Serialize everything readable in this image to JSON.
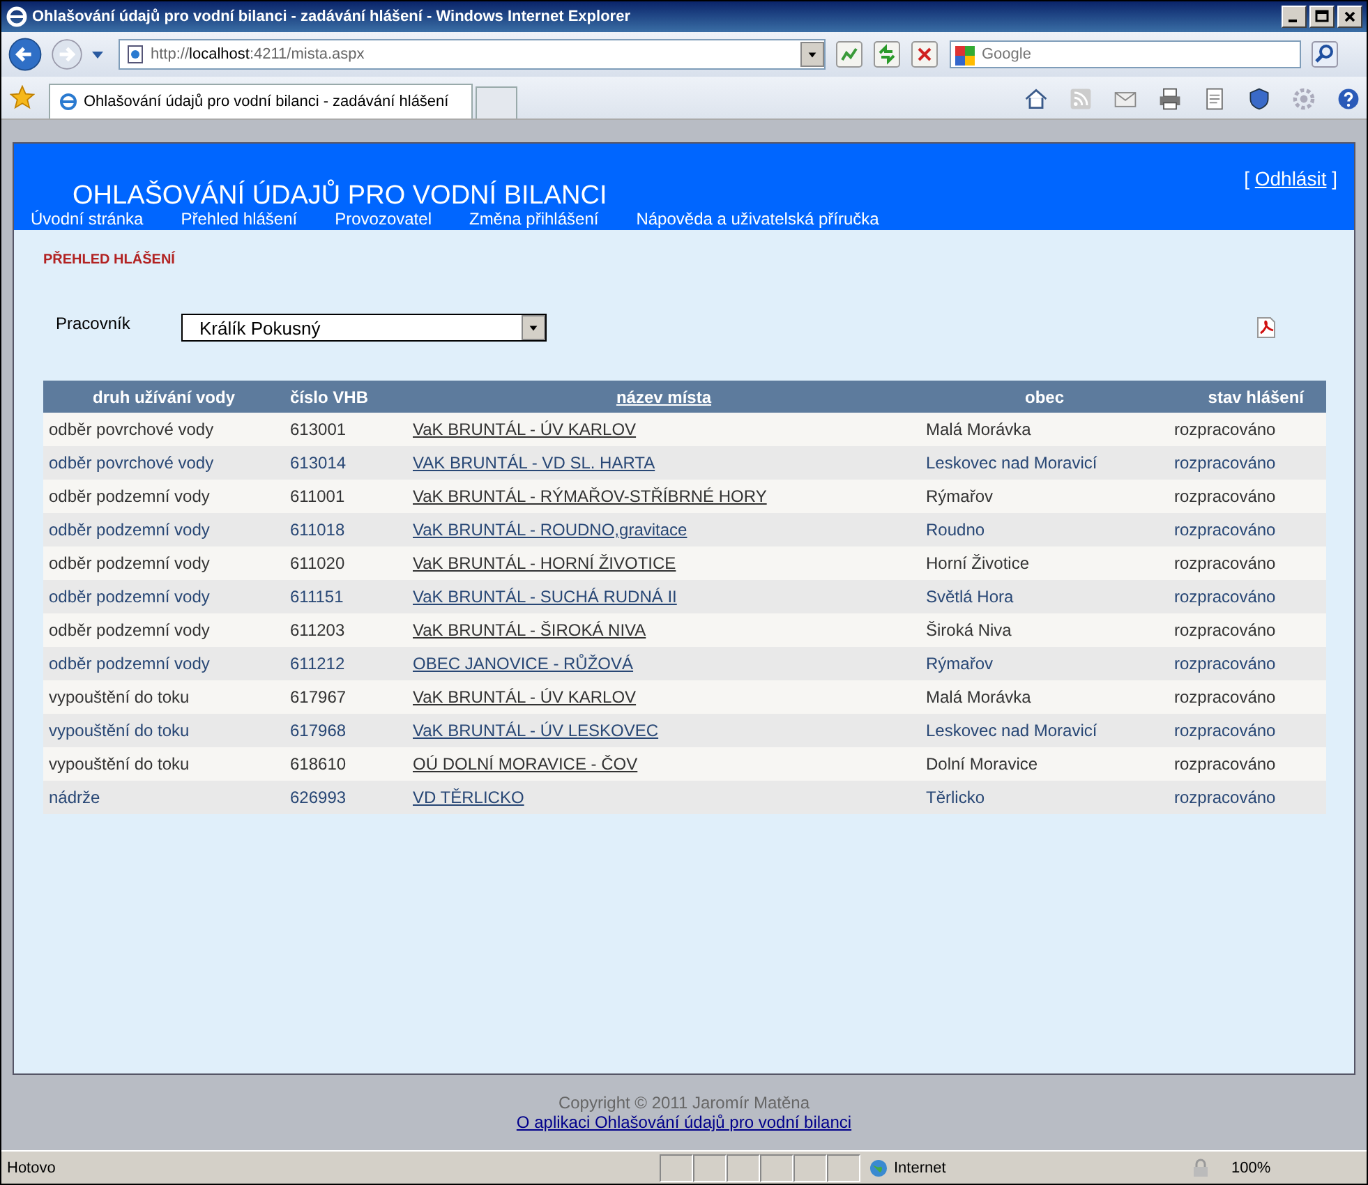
{
  "window": {
    "title": "Ohlašování údajů pro vodní bilanci - zadávání hlášení - Windows Internet Explorer"
  },
  "address_bar": {
    "url_prefix": "http://",
    "url_host": "localhost",
    "url_rest": ":4211/mista.aspx"
  },
  "search": {
    "placeholder": "Google"
  },
  "tabs": [
    {
      "label": "Ohlašování údajů pro vodní bilanci - zadávání hlášení",
      "selected": true
    }
  ],
  "page": {
    "title": "OHLAŠOVÁNÍ ÚDAJŮ PRO VODNÍ BILANCI",
    "logout_open": "[",
    "logout": "Odhlásit",
    "logout_close": "]",
    "nav": [
      "Úvodní stránka",
      "Přehled hlášení",
      "Provozovatel",
      "Změna přihlášení",
      "Nápověda a uživatelská příručka"
    ],
    "heading": "PŘEHLED HLÁŠENÍ",
    "worker_label": "Pracovník",
    "worker_value": "Králík Pokusný"
  },
  "table": {
    "columns": [
      {
        "label": "druh užívání vody",
        "link": false
      },
      {
        "label": "číslo VHB",
        "link": false
      },
      {
        "label": "název místa",
        "link": true
      },
      {
        "label": "obec",
        "link": false
      },
      {
        "label": "stav hlášení",
        "link": false
      }
    ],
    "rows": [
      [
        "odběr povrchové vody",
        "613001",
        "VaK BRUNTÁL - ÚV KARLOV",
        "Malá Morávka",
        "rozpracováno"
      ],
      [
        "odběr povrchové vody",
        "613014",
        "VAK BRUNTÁL - VD SL. HARTA",
        "Leskovec nad Moravicí",
        "rozpracováno"
      ],
      [
        "odběr podzemní vody",
        "611001",
        "VaK BRUNTÁL - RÝMAŘOV-STŘÍBRNÉ HORY",
        "Rýmařov",
        "rozpracováno"
      ],
      [
        "odběr podzemní vody",
        "611018",
        "VaK BRUNTÁL - ROUDNO,gravitace",
        "Roudno",
        "rozpracováno"
      ],
      [
        "odběr podzemní vody",
        "611020",
        "VaK BRUNTÁL - HORNÍ ŽIVOTICE",
        "Horní Životice",
        "rozpracováno"
      ],
      [
        "odběr podzemní vody",
        "611151",
        "VaK BRUNTÁL - SUCHÁ RUDNÁ II",
        "Světlá Hora",
        "rozpracováno"
      ],
      [
        "odběr podzemní vody",
        "611203",
        "VaK BRUNTÁL - ŠIROKÁ NIVA",
        "Široká Niva",
        "rozpracováno"
      ],
      [
        "odběr podzemní vody",
        "611212",
        "OBEC JANOVICE - RŮŽOVÁ",
        "Rýmařov",
        "rozpracováno"
      ],
      [
        "vypouštění do toku",
        "617967",
        "VaK BRUNTÁL - ÚV KARLOV",
        "Malá Morávka",
        "rozpracováno"
      ],
      [
        "vypouštění do toku",
        "617968",
        "VaK BRUNTÁL - ÚV LESKOVEC",
        "Leskovec nad Moravicí",
        "rozpracováno"
      ],
      [
        "vypouštění do toku",
        "618610",
        "OÚ DOLNÍ MORAVICE - ČOV",
        "Dolní Moravice",
        "rozpracováno"
      ],
      [
        "nádrže",
        "626993",
        "VD TĚRLICKO",
        "Těrlicko",
        "rozpracováno"
      ]
    ]
  },
  "footer": {
    "copyright": "Copyright © 2011 Jaromír Matěna",
    "about": "O aplikaci Ohlašování údajů pro vodní bilanci"
  },
  "status_bar": {
    "text": "Hotovo",
    "zone": "Internet",
    "zoom": "100%"
  }
}
